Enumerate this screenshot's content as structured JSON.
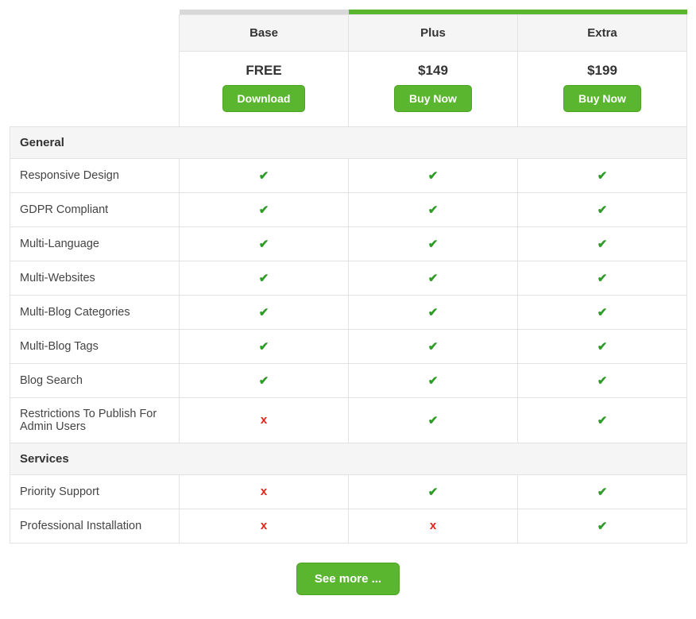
{
  "plans": [
    {
      "name": "Base",
      "price": "FREE",
      "cta": "Download",
      "accent": "muted"
    },
    {
      "name": "Plus",
      "price": "$149",
      "cta": "Buy Now",
      "accent": "green"
    },
    {
      "name": "Extra",
      "price": "$199",
      "cta": "Buy Now",
      "accent": "green"
    }
  ],
  "sections": [
    {
      "title": "General",
      "features": [
        {
          "label": "Responsive Design",
          "values": [
            true,
            true,
            true
          ]
        },
        {
          "label": "GDPR Compliant",
          "values": [
            true,
            true,
            true
          ]
        },
        {
          "label": "Multi-Language",
          "values": [
            true,
            true,
            true
          ]
        },
        {
          "label": "Multi-Websites",
          "values": [
            true,
            true,
            true
          ]
        },
        {
          "label": "Multi-Blog Categories",
          "values": [
            true,
            true,
            true
          ]
        },
        {
          "label": "Multi-Blog Tags",
          "values": [
            true,
            true,
            true
          ]
        },
        {
          "label": "Blog Search",
          "values": [
            true,
            true,
            true
          ]
        },
        {
          "label": "Restrictions To Publish For Admin Users",
          "values": [
            false,
            true,
            true
          ]
        }
      ]
    },
    {
      "title": "Services",
      "features": [
        {
          "label": "Priority Support",
          "values": [
            false,
            true,
            true
          ]
        },
        {
          "label": "Professional Installation",
          "values": [
            false,
            false,
            true
          ]
        }
      ]
    }
  ],
  "see_more_label": "See more ...",
  "icons": {
    "check": "✔",
    "cross": "x"
  },
  "colors": {
    "accent_green": "#5bb62f",
    "check_green": "#2e9b27",
    "cross_red": "#e2231a"
  }
}
